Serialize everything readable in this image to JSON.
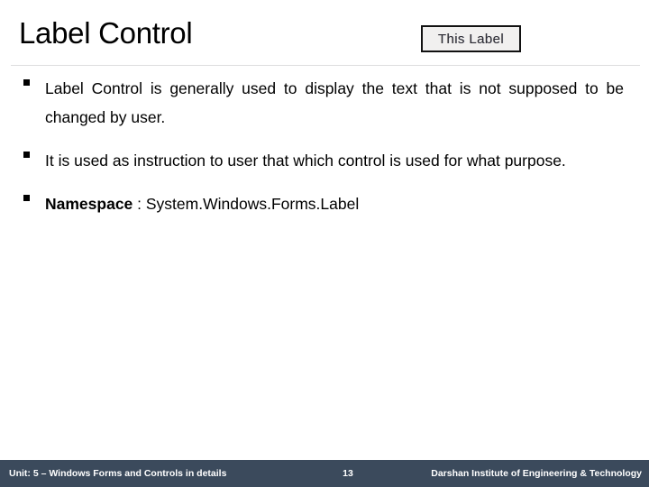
{
  "slide": {
    "title": "Label Control",
    "background_color": "#ffffff"
  },
  "figure": {
    "name": "label-control-preview",
    "caption_text": "This Label",
    "border_color": "#111111",
    "fill_color": "#f1f0ef"
  },
  "body": {
    "bullets": [
      {
        "marker": "square-bullet",
        "text": "Label Control is generally used to display the text that is not supposed to be changed by user.",
        "justified": true
      },
      {
        "marker": "square-bullet",
        "text": "It is used as instruction to user that which control is used for what purpose.",
        "justified": true
      },
      {
        "marker": "square-bullet",
        "bold_prefix": "Namespace",
        "text": " : System.Windows.Forms.Label",
        "justified": false
      }
    ]
  },
  "footer": {
    "unit_label": "Unit: 5 – Windows Forms and Controls in details",
    "page_number": "13",
    "institute": "Darshan Institute of Engineering & Technology",
    "background_color": "#3b4a5c",
    "text_color": "#ffffff"
  }
}
